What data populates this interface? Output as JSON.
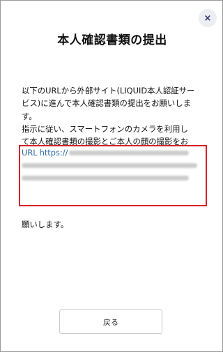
{
  "dialog": {
    "title": "本人確認書類の提出",
    "close_glyph": "×",
    "paragraphs": {
      "p1_line1": "以下のURLから外部サイト(LIQUID本人認証サー",
      "p1_line2": "ビス)に進んで本人確認書類の提出をお願いしま",
      "p1_line3": "す。",
      "p2_line1": "指示に従い、スマートフォンのカメラを利用し",
      "p2_line2": "て本人確認書類の撮影とご本人の顔の撮影をお",
      "p3_line1": "願いします。"
    },
    "url": {
      "label": "URL",
      "visible_prefix": "https://"
    },
    "back_button_label": "戻る"
  },
  "colors": {
    "link": "#2e6aa5",
    "highlight_box": "#d81f2a",
    "close_button_bg": "#eceef4"
  },
  "icons": {
    "close": "close-icon"
  }
}
